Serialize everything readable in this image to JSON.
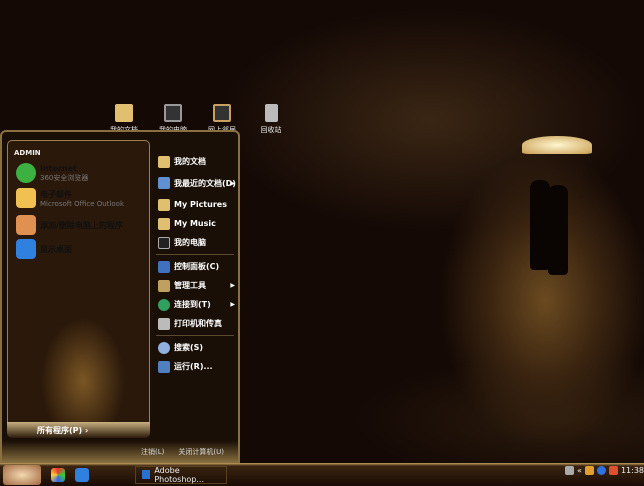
{
  "desktop": {
    "icons": [
      {
        "label": "我的文档"
      },
      {
        "label": "我的电脑"
      },
      {
        "label": "网上邻居"
      },
      {
        "label": "回收站"
      }
    ]
  },
  "start_menu": {
    "user": "ADMIN",
    "pinned": [
      {
        "title": "Internet",
        "subtitle": "360安全浏览器"
      },
      {
        "title": "电子邮件",
        "subtitle": "Microsoft Office Outlook"
      },
      {
        "title": "添加/删除电脑上的程序",
        "subtitle": ""
      },
      {
        "title": "显示桌面",
        "subtitle": ""
      }
    ],
    "all_programs": "所有程序(P)",
    "right": [
      {
        "label": "我的文档"
      },
      {
        "label": "我最近的文档(D)",
        "arrow": true
      },
      {
        "label": "My Pictures"
      },
      {
        "label": "My Music"
      },
      {
        "label": "我的电脑"
      },
      {
        "label": "控制面板(C)"
      },
      {
        "label": "管理工具",
        "arrow": true
      },
      {
        "label": "连接到(T)",
        "arrow": true
      },
      {
        "label": "打印机和传真"
      },
      {
        "label": "搜索(S)"
      },
      {
        "label": "运行(R)..."
      }
    ],
    "logoff": "注销(L)",
    "shutdown": "关闭计算机(U)"
  },
  "taskbar": {
    "task": "Adobe Photoshop...",
    "clock": "11:38"
  }
}
